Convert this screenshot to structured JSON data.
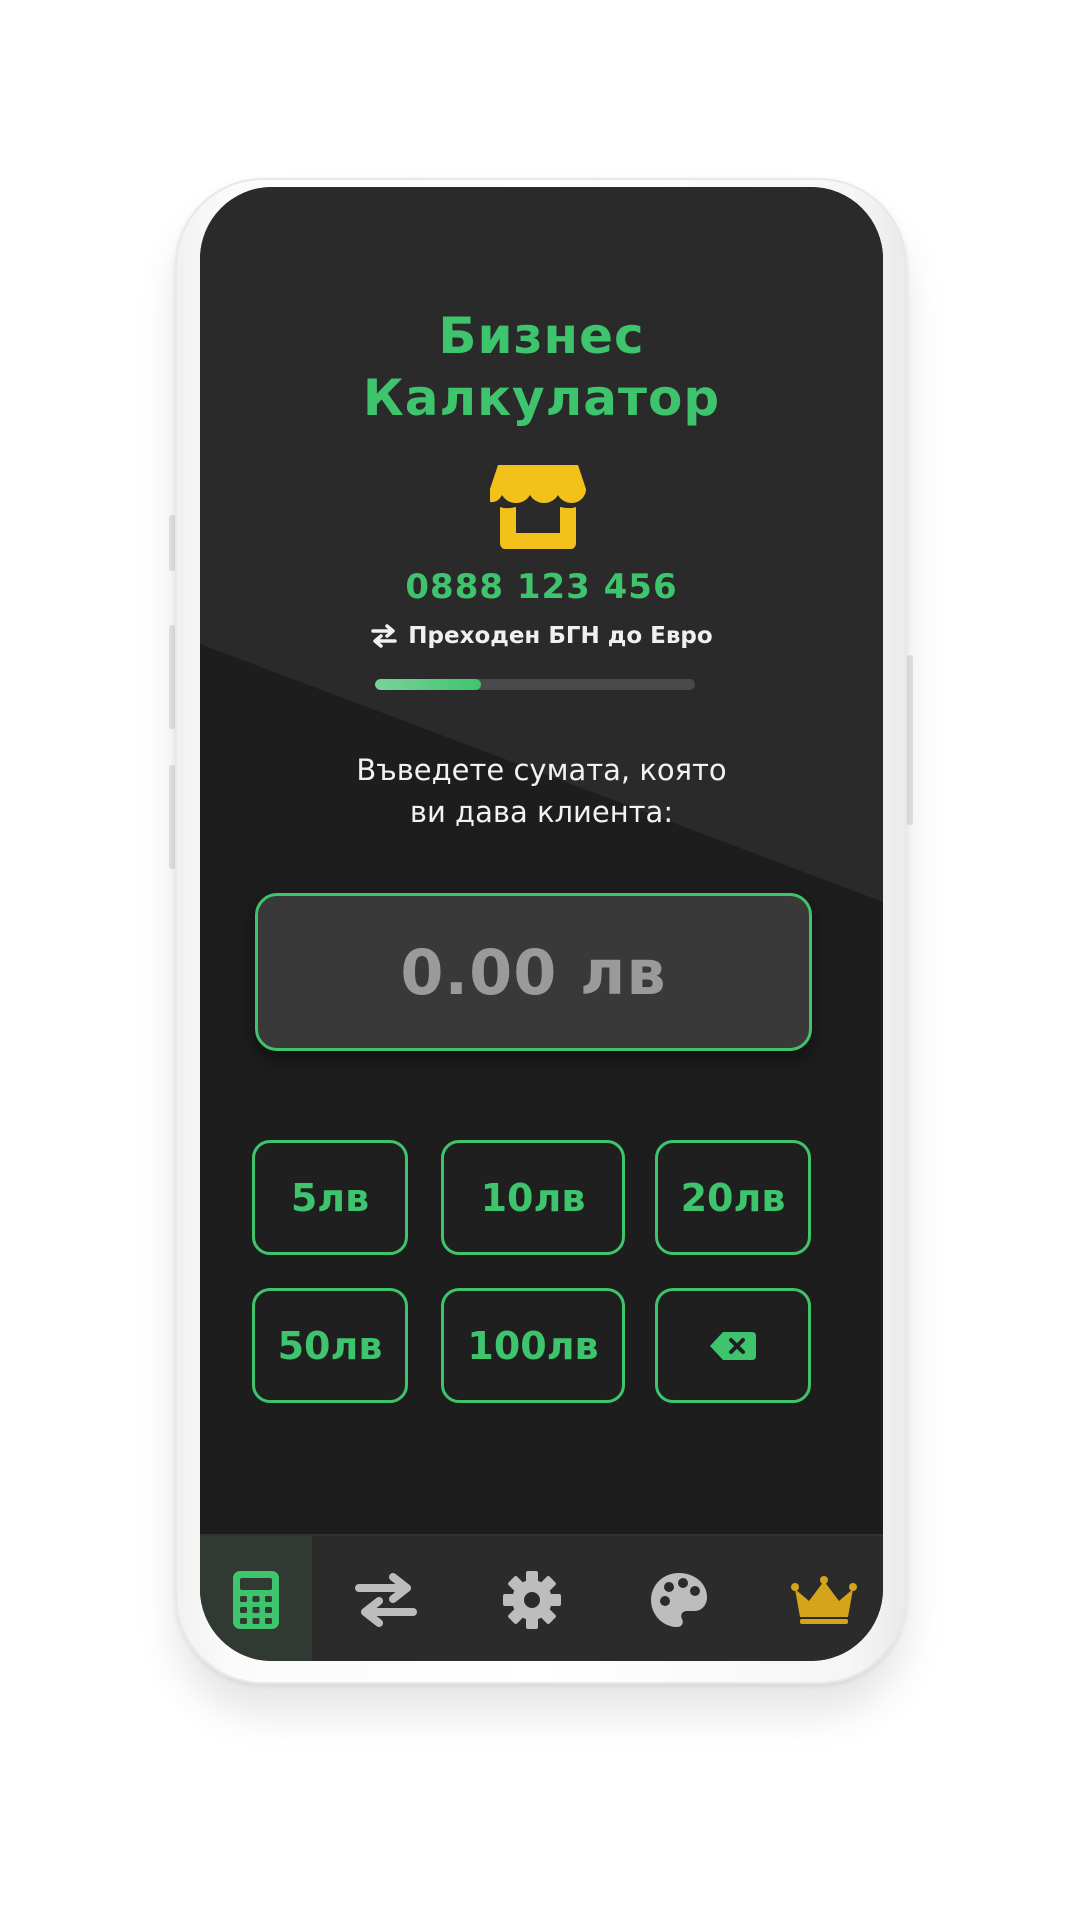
{
  "app": {
    "title_line1": "Бизнес",
    "title_line2": "Калкулатор",
    "phone": "0888 123 456",
    "transition_label": "Преходен БГН до Евро",
    "transition_progress": 0.33
  },
  "prompt": {
    "line1": "Въведете сумата, която",
    "line2": "ви дава клиента:"
  },
  "amount": {
    "value": "0.00 лв"
  },
  "keypad": {
    "k5": "5лв",
    "k10": "10лв",
    "k20": "20лв",
    "k50": "50лв",
    "k100": "100лв"
  },
  "icons": {
    "shop": "store-icon",
    "transition": "swap-arrows-icon",
    "backspace": "backspace-icon",
    "nav_calculator": "calculator-icon",
    "nav_exchange": "exchange-icon",
    "nav_settings": "gear-icon",
    "nav_themes": "palette-icon",
    "nav_premium": "crown-icon"
  },
  "colors": {
    "accent": "#3ec46d",
    "gold": "#f2c21b",
    "background": "#1d1d1d"
  }
}
